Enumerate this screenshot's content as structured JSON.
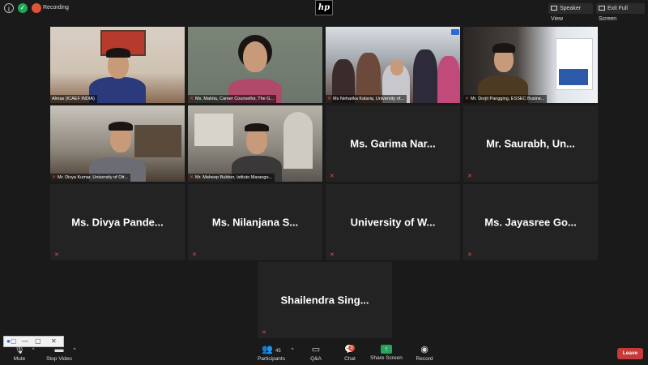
{
  "topbar": {
    "recording_label": "Recording",
    "speaker_view_label": "Speaker View",
    "exit_fullscreen_label": "Exit Full Screen",
    "logo_text": "hp"
  },
  "tiles": {
    "almas": "Almas  (ICAEF INDIA)",
    "mahita": "Ms. Mahita, Career Counsellor, The G...",
    "neharika": "Ms Neharika Kataria, University of...",
    "dorjit": "Mr. Dorjit Pangging, ESSEC Busine...",
    "divya_kumar": "Mr. Divya Kumar, University of Ott...",
    "maheep": "Mr. Maheep Bubber, Istituto Marango...",
    "garima": "Ms.  Garima Nar...",
    "saurabh": "Mr. Saurabh, Un...",
    "divya_pande": "Ms.  Divya Pande...",
    "nilanjana": "Ms.  Nilanjana S...",
    "univ_w": "University of W...",
    "jayasree": "Ms. Jayasree Go...",
    "shailendra": "Shailendra Sing..."
  },
  "toolbar": {
    "mute": "Mute",
    "stop_video": "Stop Video",
    "participants": "Participants",
    "participants_count": "45",
    "qa": "Q&A",
    "chat": "Chat",
    "chat_badge": "3",
    "share_screen": "Share Screen",
    "record": "Record",
    "leave": "Leave"
  }
}
